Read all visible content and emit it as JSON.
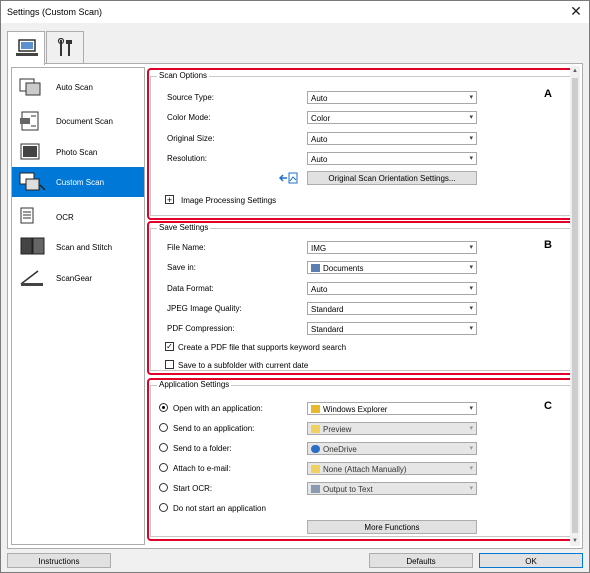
{
  "window": {
    "title": "Settings (Custom Scan)",
    "close_glyph": "✕"
  },
  "tabs": [
    {
      "icon": "scan-computer-icon"
    },
    {
      "icon": "tools-icon"
    }
  ],
  "sidebar": {
    "items": [
      {
        "label": "Auto Scan",
        "icon": "auto-scan-icon"
      },
      {
        "label": "Document Scan",
        "icon": "document-scan-icon"
      },
      {
        "label": "Photo Scan",
        "icon": "photo-scan-icon"
      },
      {
        "label": "Custom Scan",
        "icon": "custom-scan-icon",
        "selected": true
      },
      {
        "label": "OCR",
        "icon": "ocr-icon"
      },
      {
        "label": "Scan and Stitch",
        "icon": "scan-stitch-icon"
      },
      {
        "label": "ScanGear",
        "icon": "scangear-icon"
      }
    ]
  },
  "scan_options": {
    "title": "Scan Options",
    "marker": "A",
    "source_type": {
      "label": "Source Type:",
      "value": "Auto"
    },
    "color_mode": {
      "label": "Color Mode:",
      "value": "Color"
    },
    "original_size": {
      "label": "Original Size:",
      "value": "Auto"
    },
    "resolution": {
      "label": "Resolution:",
      "value": "Auto"
    },
    "orientation_button": "Original Scan Orientation Settings...",
    "image_processing": {
      "expander": "+",
      "label": "Image Processing Settings"
    }
  },
  "save_settings": {
    "title": "Save Settings",
    "marker": "B",
    "file_name": {
      "label": "File Name:",
      "value": "IMG"
    },
    "save_in": {
      "label": "Save in:",
      "value": "Documents"
    },
    "data_format": {
      "label": "Data Format:",
      "value": "Auto"
    },
    "jpeg_quality": {
      "label": "JPEG Image Quality:",
      "value": "Standard"
    },
    "pdf_compression": {
      "label": "PDF Compression:",
      "value": "Standard"
    },
    "keyword_pdf": {
      "label": "Create a PDF file that supports keyword search",
      "checked": true
    },
    "subfolder": {
      "label": "Save to a subfolder with current date",
      "checked": false
    }
  },
  "app_settings": {
    "title": "Application Settings",
    "marker": "C",
    "options": [
      {
        "label": "Open with an application:",
        "value": "Windows Explorer",
        "selected": true,
        "enabled": true
      },
      {
        "label": "Send to an application:",
        "value": "Preview",
        "selected": false,
        "enabled": false
      },
      {
        "label": "Send to a folder:",
        "value": "OneDrive",
        "selected": false,
        "enabled": false
      },
      {
        "label": "Attach to e-mail:",
        "value": "None (Attach Manually)",
        "selected": false,
        "enabled": false
      },
      {
        "label": "Start OCR:",
        "value": "Output to Text",
        "selected": false,
        "enabled": false
      },
      {
        "label": "Do not start an application",
        "selected": false
      }
    ],
    "more_functions": "More Functions"
  },
  "footer": {
    "instructions": "Instructions",
    "defaults": "Defaults",
    "ok": "OK"
  },
  "colors": {
    "accent": "#0078d7",
    "highlight_box": "#e0002a"
  }
}
